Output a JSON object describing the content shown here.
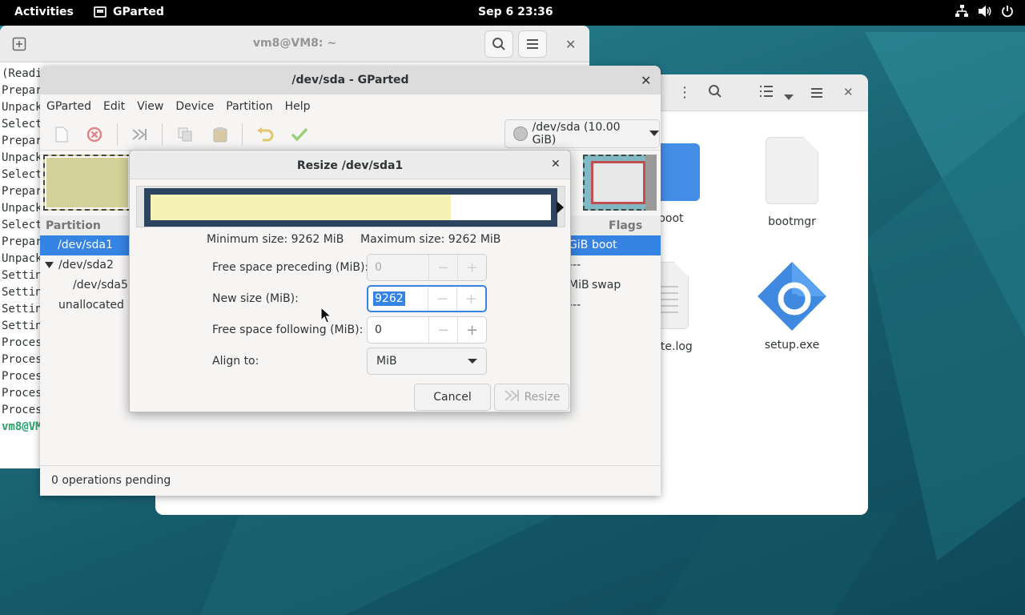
{
  "topbar": {
    "activities": "Activities",
    "app_name": "GParted",
    "clock": "Sep 6  23:36"
  },
  "terminal": {
    "title": "vm8@VM8: ~",
    "lines": [
      "(Readi",
      "Prepar",
      "Unpack",
      "Select",
      "Prepar",
      "Unpack",
      "Select",
      "Prepar",
      "Unpack",
      "Select",
      "Prepar",
      "Unpack",
      "Settin",
      "Settin",
      "Settin",
      "Settin",
      "Proces",
      "Proces",
      "Proces",
      "Proces",
      "Proces"
    ],
    "prompt": "vm8@VM"
  },
  "files": {
    "items": [
      {
        "label": "boot"
      },
      {
        "label": "bootmgr"
      },
      {
        "label": "ite.log"
      },
      {
        "label": "setup.exe"
      }
    ]
  },
  "gparted": {
    "title": "/dev/sda - GParted",
    "menu": [
      "GParted",
      "Edit",
      "View",
      "Device",
      "Partition",
      "Help"
    ],
    "device": "/dev/sda (10.00 GiB)",
    "columns": {
      "partition": "Partition",
      "flags": "Flags"
    },
    "rows": [
      {
        "partition": "/dev/sda1",
        "size_tail": "GiB",
        "flags": "boot"
      },
      {
        "partition": "/dev/sda2",
        "size_tail": "---",
        "flags": ""
      },
      {
        "partition": "/dev/sda5",
        "size_tail": "MiB",
        "flags": "swap"
      },
      {
        "partition": "unallocated",
        "size_tail": "---",
        "flags": ""
      }
    ],
    "status": "0 operations pending"
  },
  "dialog": {
    "title": "Resize /dev/sda1",
    "min_size": "Minimum size: 9262 MiB",
    "max_size": "Maximum size: 9262 MiB",
    "used_fraction": 0.75,
    "free_preceding": {
      "label": "Free space preceding (MiB):",
      "value": "0"
    },
    "new_size": {
      "label": "New size (MiB):",
      "value": "9262"
    },
    "free_following": {
      "label": "Free space following (MiB):",
      "value": "0"
    },
    "align": {
      "label": "Align to:",
      "value": "MiB"
    },
    "cancel": "Cancel",
    "resize": "Resize"
  }
}
